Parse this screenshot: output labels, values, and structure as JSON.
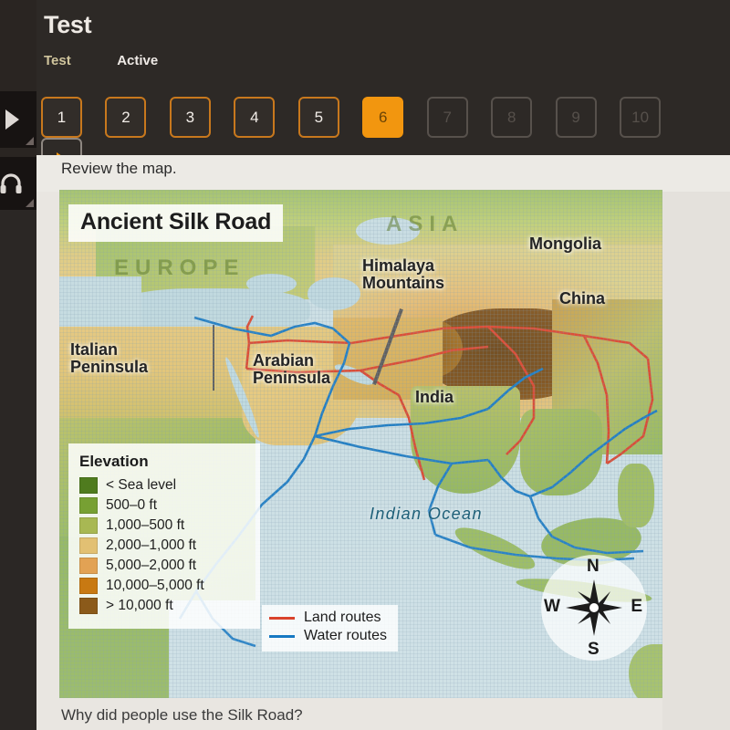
{
  "app": {
    "title": "Test",
    "tabs": [
      {
        "label": "Test",
        "state": "selected"
      },
      {
        "label": "Active",
        "state": "normal"
      }
    ],
    "rail_icons": [
      "pointer-icon",
      "headphones-icon"
    ]
  },
  "pager": {
    "buttons": [
      {
        "label": "1",
        "state": "answered"
      },
      {
        "label": "2",
        "state": "answered"
      },
      {
        "label": "3",
        "state": "answered"
      },
      {
        "label": "4",
        "state": "answered"
      },
      {
        "label": "5",
        "state": "answered"
      },
      {
        "label": "6",
        "state": "current"
      },
      {
        "label": "7",
        "state": "disabled"
      },
      {
        "label": "8",
        "state": "disabled"
      },
      {
        "label": "9",
        "state": "disabled"
      },
      {
        "label": "10",
        "state": "disabled"
      }
    ],
    "next_icon": "play-arrow-icon",
    "accent_color": "#f2960f",
    "border_color": "#c8781d"
  },
  "content": {
    "prompt": "Review the map.",
    "question": "Why did people use the Silk Road?"
  },
  "map": {
    "title": "Ancient Silk Road",
    "continents": [
      {
        "name": "EUROPE"
      },
      {
        "name": "ASIA"
      }
    ],
    "places": [
      {
        "name": "Mongolia"
      },
      {
        "name": "Himalaya\nMountains"
      },
      {
        "name": "China"
      },
      {
        "name": "Italian\nPeninsula"
      },
      {
        "name": "Arabian\nPeninsula"
      },
      {
        "name": "India"
      }
    ],
    "ocean": "Indian Ocean",
    "legend": {
      "title": "Elevation",
      "items": [
        {
          "label": "< Sea level",
          "color": "#4f7b1e"
        },
        {
          "label": "500–0 ft",
          "color": "#77a033"
        },
        {
          "label": "1,000–500 ft",
          "color": "#a8b853"
        },
        {
          "label": "2,000–1,000 ft",
          "color": "#e2c073"
        },
        {
          "label": "5,000–2,000 ft",
          "color": "#e2a254"
        },
        {
          "label": "10,000–5,000 ft",
          "color": "#c87912"
        },
        {
          "label": "> 10,000 ft",
          "color": "#8b5a1a"
        }
      ]
    },
    "routes": [
      {
        "label": "Land routes",
        "color": "#d9422b"
      },
      {
        "label": "Water routes",
        "color": "#1678c2"
      }
    ],
    "compass": {
      "north": "N",
      "south": "S",
      "west": "W",
      "east": "E",
      "icon": "compass-rose-icon"
    }
  }
}
